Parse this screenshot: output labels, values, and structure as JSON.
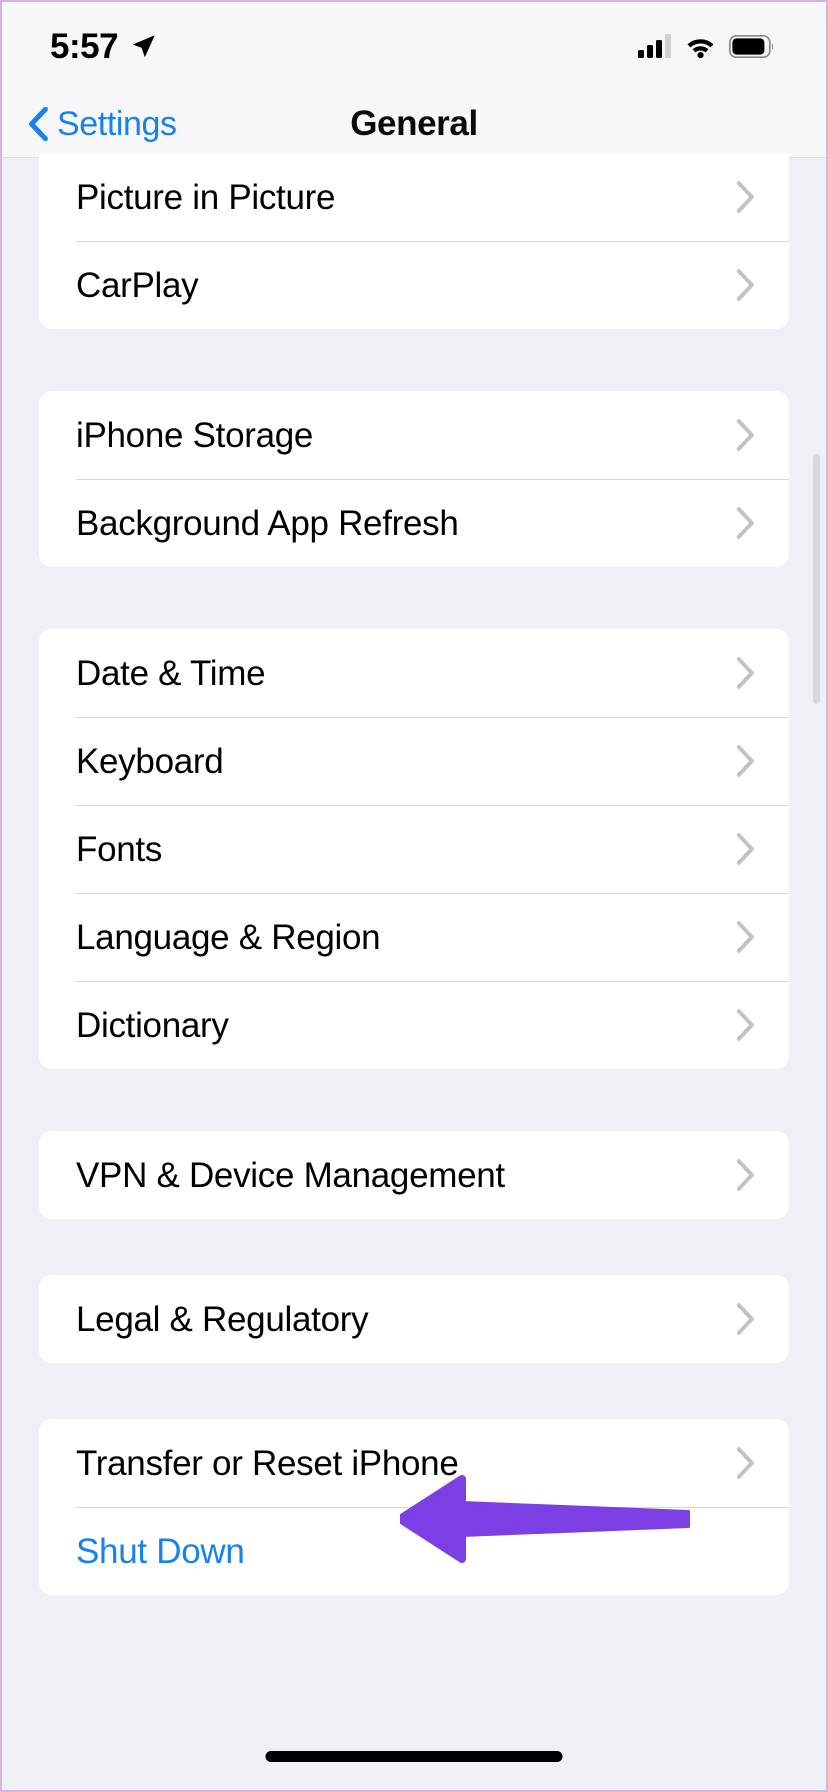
{
  "status_bar": {
    "time": "5:57",
    "location_icon": "location-arrow-icon",
    "cellular_icon": "cellular-signal-icon",
    "cellular_bars_filled": 3,
    "cellular_bars_total": 4,
    "wifi_icon": "wifi-icon",
    "battery_icon": "battery-icon",
    "battery_level_percent": 85
  },
  "nav": {
    "back_label": "Settings",
    "back_icon": "chevron-left-icon",
    "title": "General"
  },
  "colors": {
    "page_background": "#F0EFF5",
    "card_background": "#FFFFFF",
    "accent_blue": "#1783E8",
    "annotation_purple": "#7B3FE4",
    "separator": "#D6D6DA",
    "chevron_gray": "#C2C2C7"
  },
  "sections": [
    {
      "id": "media",
      "clipped_top": true,
      "rows": [
        {
          "label": "Picture in Picture",
          "accessory": "chevron-right-icon",
          "style": "default"
        },
        {
          "label": "CarPlay",
          "accessory": "chevron-right-icon",
          "style": "default"
        }
      ]
    },
    {
      "id": "storage",
      "clipped_top": false,
      "rows": [
        {
          "label": "iPhone Storage",
          "accessory": "chevron-right-icon",
          "style": "default"
        },
        {
          "label": "Background App Refresh",
          "accessory": "chevron-right-icon",
          "style": "default"
        }
      ]
    },
    {
      "id": "localization",
      "clipped_top": false,
      "rows": [
        {
          "label": "Date & Time",
          "accessory": "chevron-right-icon",
          "style": "default"
        },
        {
          "label": "Keyboard",
          "accessory": "chevron-right-icon",
          "style": "default"
        },
        {
          "label": "Fonts",
          "accessory": "chevron-right-icon",
          "style": "default"
        },
        {
          "label": "Language & Region",
          "accessory": "chevron-right-icon",
          "style": "default"
        },
        {
          "label": "Dictionary",
          "accessory": "chevron-right-icon",
          "style": "default"
        }
      ]
    },
    {
      "id": "vpn",
      "clipped_top": false,
      "rows": [
        {
          "label": "VPN & Device Management",
          "accessory": "chevron-right-icon",
          "style": "default"
        }
      ]
    },
    {
      "id": "legal",
      "clipped_top": false,
      "rows": [
        {
          "label": "Legal & Regulatory",
          "accessory": "chevron-right-icon",
          "style": "default"
        }
      ]
    },
    {
      "id": "reset",
      "clipped_top": false,
      "rows": [
        {
          "label": "Transfer or Reset iPhone",
          "accessory": "chevron-right-icon",
          "style": "default"
        },
        {
          "label": "Shut Down",
          "accessory": "none",
          "style": "blue"
        }
      ]
    }
  ],
  "annotation": {
    "type": "arrow",
    "direction": "left",
    "color": "#7B3FE4",
    "points_at": "Transfer or Reset iPhone"
  },
  "home_indicator": "home-indicator"
}
